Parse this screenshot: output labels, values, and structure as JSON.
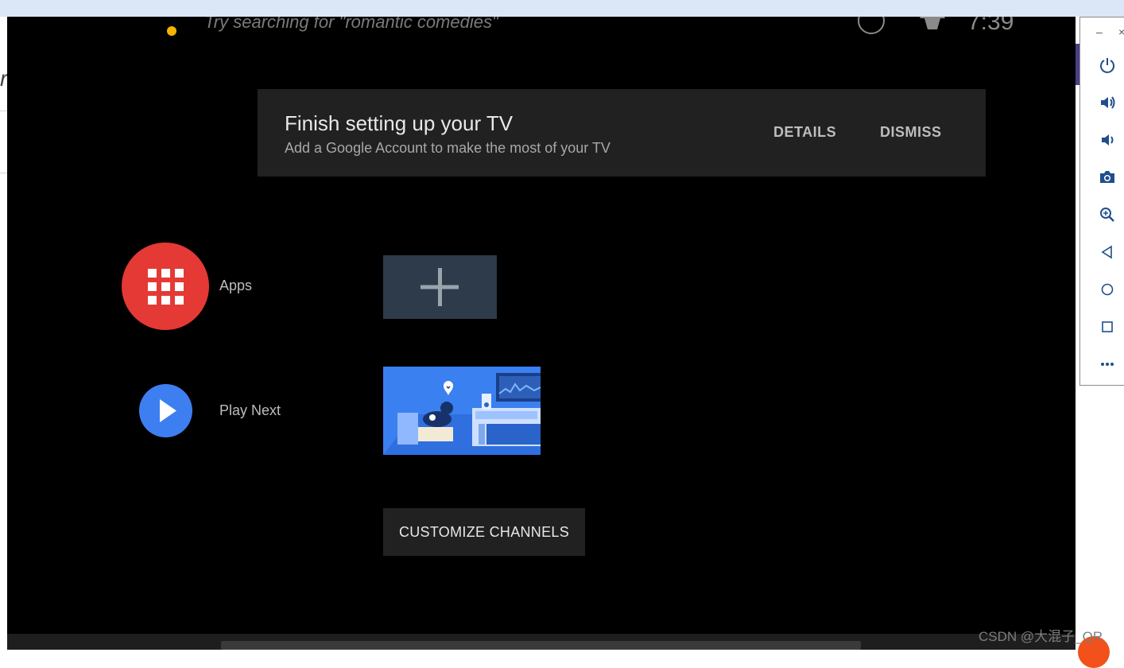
{
  "tv": {
    "search_hint": "Try searching for \"romantic comedies\"",
    "clock": "7:39",
    "notification": {
      "title": "Finish setting up your TV",
      "subtitle": "Add a Google Account to make the most of your TV",
      "details_label": "DETAILS",
      "dismiss_label": "DISMISS"
    },
    "rows": {
      "apps_label": "Apps",
      "play_next_label": "Play Next"
    },
    "customize_label": "CUSTOMIZE CHANNELS",
    "colors": {
      "apps": "#e53935",
      "play_next": "#3d7ff0",
      "search_dot": "#f5b400"
    }
  },
  "emulator_sidebar": {
    "minimize": "–",
    "close": "×",
    "buttons": [
      "power-icon",
      "volume-up-icon",
      "volume-down-icon",
      "camera-icon",
      "zoom-icon",
      "back-icon",
      "home-icon",
      "overview-icon",
      "more-icon"
    ]
  },
  "watermark": "CSDN @大混子_QR"
}
